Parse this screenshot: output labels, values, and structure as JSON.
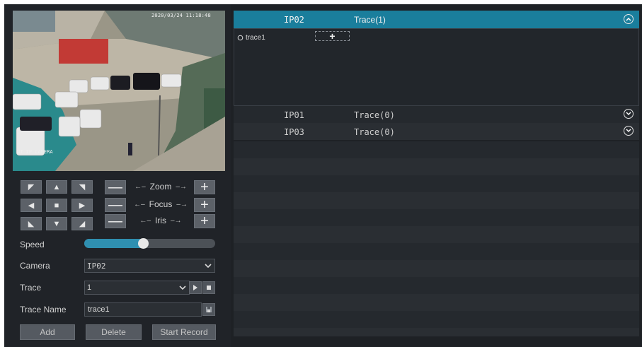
{
  "video": {
    "timestamp": "2020/03/24 11:18:48",
    "camera_label": "NT IP CAMERA"
  },
  "ptz": {
    "zoom_label": "Zoom",
    "focus_label": "Focus",
    "iris_label": "Iris",
    "minus_glyph": "—",
    "plus_glyph": "+",
    "left_arrow": "←–",
    "right_arrow": "–→",
    "directions": [
      "◤",
      "▲",
      "◥",
      "◀",
      "■",
      "▶",
      "◣",
      "▼",
      "◢"
    ]
  },
  "speed": {
    "label": "Speed",
    "value_fraction": 0.44
  },
  "camera": {
    "label": "Camera",
    "value": "IP02"
  },
  "trace": {
    "label": "Trace",
    "value": "1"
  },
  "trace_name": {
    "label": "Trace Name",
    "value": "trace1"
  },
  "buttons": {
    "add": "Add",
    "delete": "Delete",
    "start_record": "Start Record"
  },
  "channels": [
    {
      "name": "IP02",
      "trace": "Trace(1)",
      "expanded": true
    },
    {
      "name": "IP01",
      "trace": "Trace(0)",
      "expanded": false
    },
    {
      "name": "IP03",
      "trace": "Trace(0)",
      "expanded": false
    }
  ],
  "expanded_panel": {
    "item": "trace1",
    "add_glyph": "+"
  },
  "colors": {
    "accent": "#1a7e9c",
    "slider_fill": "#2f8fb0",
    "background": "#1e2125"
  }
}
